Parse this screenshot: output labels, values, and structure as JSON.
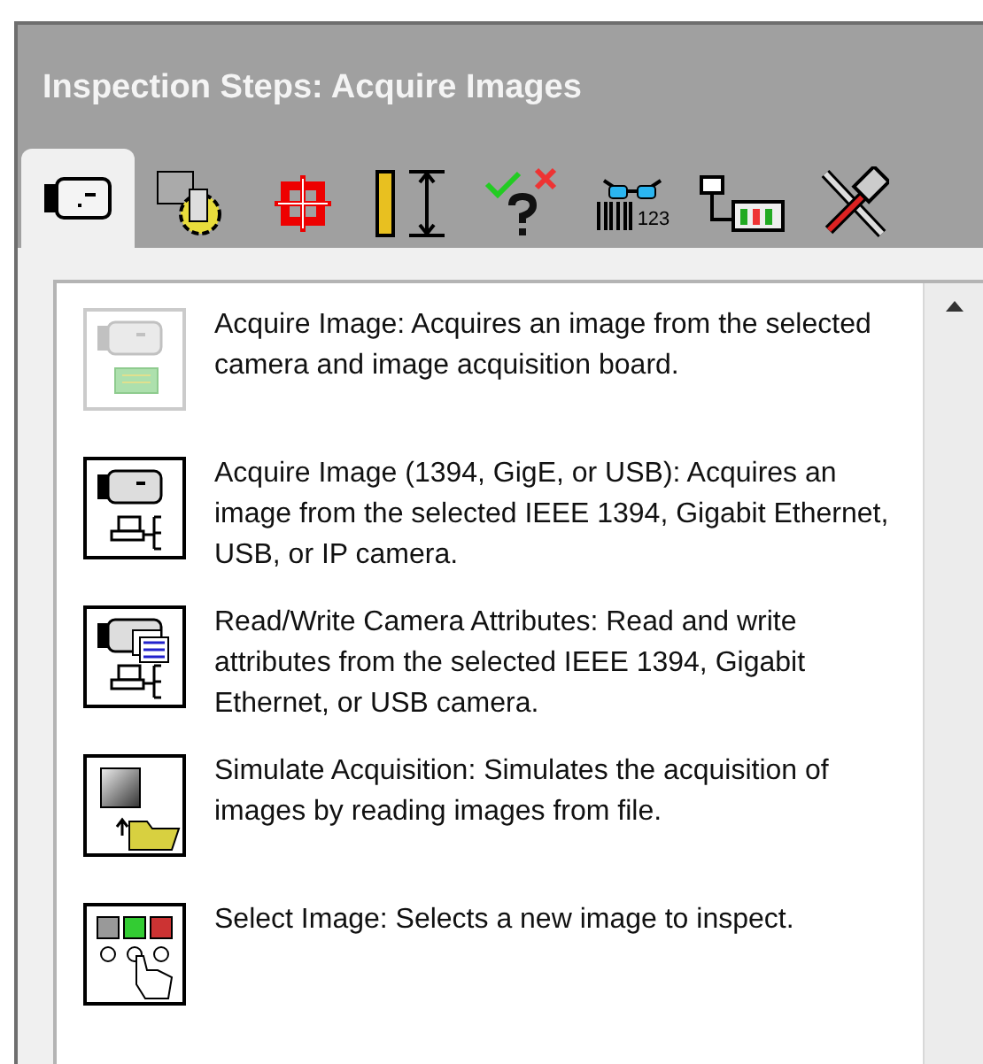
{
  "panel": {
    "title": "Inspection Steps: Acquire Images"
  },
  "tabs": [
    {
      "kind": "camera",
      "selected": true
    },
    {
      "kind": "gear",
      "selected": false
    },
    {
      "kind": "crosshair",
      "selected": false
    },
    {
      "kind": "ruler",
      "selected": false
    },
    {
      "kind": "check",
      "selected": false
    },
    {
      "kind": "barcode",
      "label": "123",
      "selected": false
    },
    {
      "kind": "device",
      "selected": false
    },
    {
      "kind": "tools",
      "selected": false
    }
  ],
  "steps": [
    {
      "kind": "camera-board",
      "disabled": true,
      "text": "Acquire Image:  Acquires an image from the selected camera and image acquisition board."
    },
    {
      "kind": "camera-network",
      "disabled": false,
      "text": "Acquire Image (1394, GigE, or USB): Acquires an image from the selected IEEE 1394, Gigabit Ethernet, USB, or IP camera."
    },
    {
      "kind": "camera-attributes",
      "disabled": false,
      "text": "Read/Write Camera Attributes:  Read and write attributes from the selected IEEE 1394, Gigabit Ethernet, or USB camera."
    },
    {
      "kind": "simulate",
      "disabled": false,
      "text": "Simulate Acquisition:  Simulates the acquisition of images by reading images from file."
    },
    {
      "kind": "select",
      "disabled": false,
      "text": "Select Image:  Selects a new image to inspect."
    }
  ]
}
